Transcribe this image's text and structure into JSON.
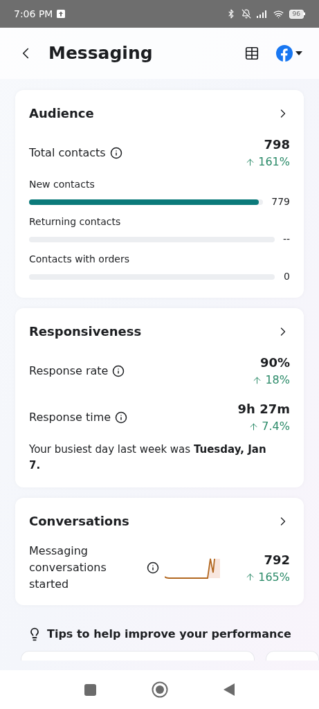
{
  "status_bar": {
    "time": "7:06 PM",
    "battery": "96"
  },
  "header": {
    "title": "Messaging"
  },
  "audience": {
    "title": "Audience",
    "total": {
      "label": "Total contacts",
      "value": "798",
      "change": "161%"
    },
    "bars": [
      {
        "label": "New contacts",
        "level": 0.98,
        "reading": "779"
      },
      {
        "label": "Returning contacts",
        "reading": "--"
      },
      {
        "label": "Contacts with orders",
        "reading": "0"
      }
    ]
  },
  "responsiveness": {
    "title": "Responsiveness",
    "metrics": [
      {
        "label": "Response rate",
        "value": "90%",
        "change": "18%"
      },
      {
        "label": "Response time",
        "value": "9h 27m",
        "change": "7.4%"
      }
    ],
    "note": "Your busiest day last week was **Tuesday, Jan 7.**"
  },
  "conversations": {
    "title": "Conversations",
    "metric": {
      "label": "Messaging conversations started",
      "value": "792",
      "change": "165%"
    }
  },
  "tips": {
    "title": "Tips to help improve your performance"
  }
}
